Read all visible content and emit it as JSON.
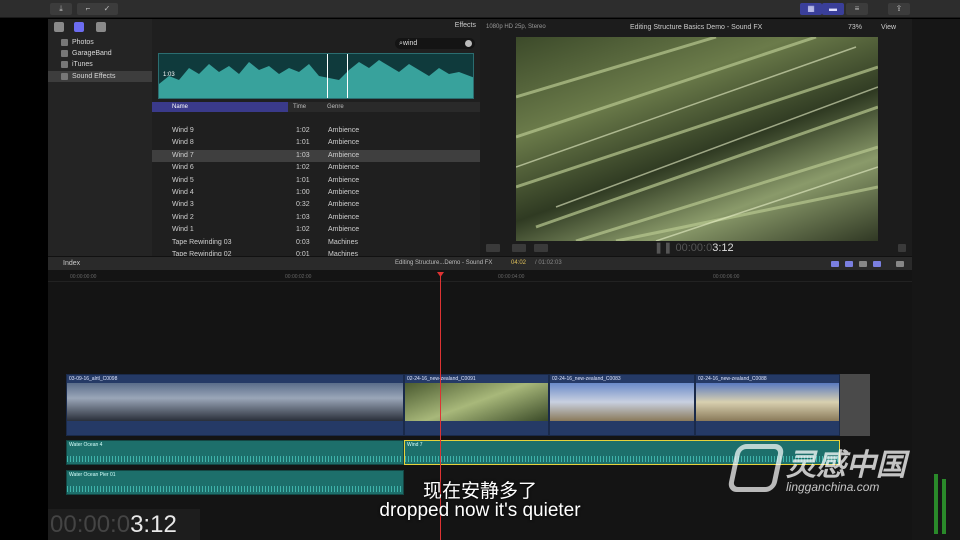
{
  "sidebar": {
    "items": [
      {
        "label": "Photos"
      },
      {
        "label": "GarageBand"
      },
      {
        "label": "iTunes"
      },
      {
        "label": "Sound Effects"
      }
    ]
  },
  "browser": {
    "title": "Effects",
    "search_value": "wind",
    "waveform_duration": "1:03",
    "columns": {
      "name": "Name",
      "time": "Time",
      "genre": "Genre"
    },
    "rows": [
      {
        "name": "Wind 9",
        "time": "1:02",
        "genre": "Ambience"
      },
      {
        "name": "Wind 8",
        "time": "1:01",
        "genre": "Ambience"
      },
      {
        "name": "Wind 7",
        "time": "1:03",
        "genre": "Ambience"
      },
      {
        "name": "Wind 6",
        "time": "1:02",
        "genre": "Ambience"
      },
      {
        "name": "Wind 5",
        "time": "1:01",
        "genre": "Ambience"
      },
      {
        "name": "Wind 4",
        "time": "1:00",
        "genre": "Ambience"
      },
      {
        "name": "Wind 3",
        "time": "0:32",
        "genre": "Ambience"
      },
      {
        "name": "Wind 2",
        "time": "1:03",
        "genre": "Ambience"
      },
      {
        "name": "Wind 1",
        "time": "1:02",
        "genre": "Ambience"
      },
      {
        "name": "Tape Rewinding 03",
        "time": "0:03",
        "genre": "Machines"
      },
      {
        "name": "Tape Rewinding 02",
        "time": "0:01",
        "genre": "Machines"
      }
    ]
  },
  "viewer": {
    "format": "1080p HD 25p, Stereo",
    "title": "Editing Structure Basics Demo - Sound FX",
    "zoom": "73%",
    "view_label": "View",
    "timecode_dim": "00:00:0",
    "timecode_bright": "3:12"
  },
  "timeline": {
    "index_label": "Index",
    "project_name": "Editing Structure...Demo - Sound FX",
    "current_tc": "04:02",
    "total_tc": "/ 01:02:03",
    "ruler": [
      "00:00:00:00",
      "00:00:02:00",
      "00:00:04:00",
      "00:00:06:00"
    ],
    "video_clips": [
      {
        "label": "03-09-16_alrtl_C0098"
      },
      {
        "label": "02-24-16_new-zealand_C0091"
      },
      {
        "label": "02-24-16_new-zealand_C0083"
      },
      {
        "label": "02-24-16_new-zealand_C0088"
      }
    ],
    "audio_clips": [
      {
        "label": "Water Ocean 4"
      },
      {
        "label": "Wind 7"
      },
      {
        "label": "Water Ocean Pier 01"
      }
    ]
  },
  "overlay": {
    "subtitle_cn": "现在安静多了",
    "subtitle_en": "dropped now it's quieter",
    "big_tc_dim": "00:00:0",
    "big_tc_bright": "3:12",
    "watermark_cn": "灵感中国",
    "watermark_en": "lingganchina.com"
  },
  "colors": {
    "accent": "#3a3f9a",
    "playhead": "#dd3333",
    "selection": "#e6d23a",
    "audio": "#1d6f6b",
    "video": "#253a66"
  }
}
